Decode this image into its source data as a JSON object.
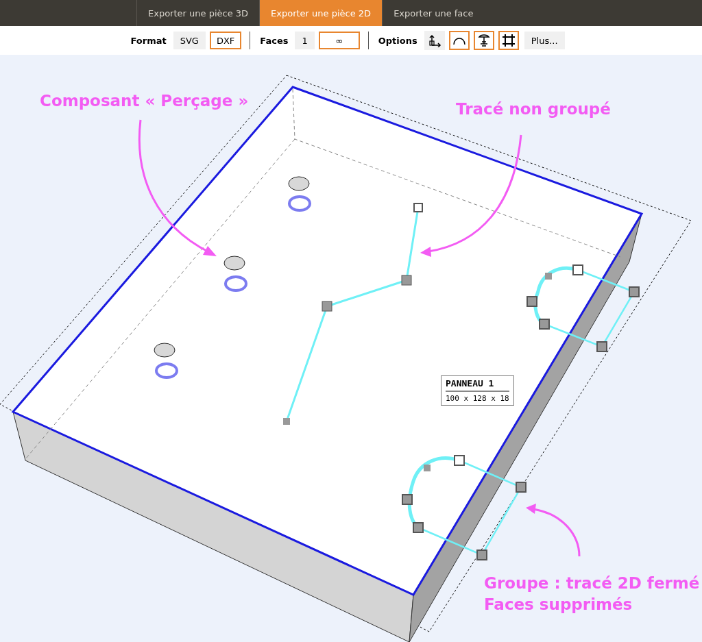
{
  "tabs": [
    {
      "label": "Exporter une pièce 3D",
      "selected": false
    },
    {
      "label": "Exporter une pièce 2D",
      "selected": true
    },
    {
      "label": "Exporter une face",
      "selected": false
    }
  ],
  "toolbar": {
    "format": {
      "label": "Format",
      "options": [
        {
          "label": "SVG",
          "selected": false
        },
        {
          "label": "DXF",
          "selected": true
        }
      ]
    },
    "faces": {
      "label": "Faces",
      "options": [
        {
          "label": "1",
          "selected": false
        },
        {
          "label": "∞",
          "selected": true
        }
      ]
    },
    "options": {
      "label": "Options",
      "toggles": [
        {
          "kind": "axes",
          "on": false
        },
        {
          "kind": "arc",
          "on": true
        },
        {
          "kind": "drill",
          "on": true
        },
        {
          "kind": "frame",
          "on": true
        }
      ],
      "more": "Plus..."
    }
  },
  "panel_label": {
    "name": "PANNEAU 1",
    "dimensions": "100 x 128 x 18"
  },
  "annotations": [
    {
      "text": "Composant « Perçage »"
    },
    {
      "text": "Tracé non groupé"
    },
    {
      "text": "Groupe : tracé 2D fermé"
    },
    {
      "text": "Faces supprimés"
    }
  ]
}
